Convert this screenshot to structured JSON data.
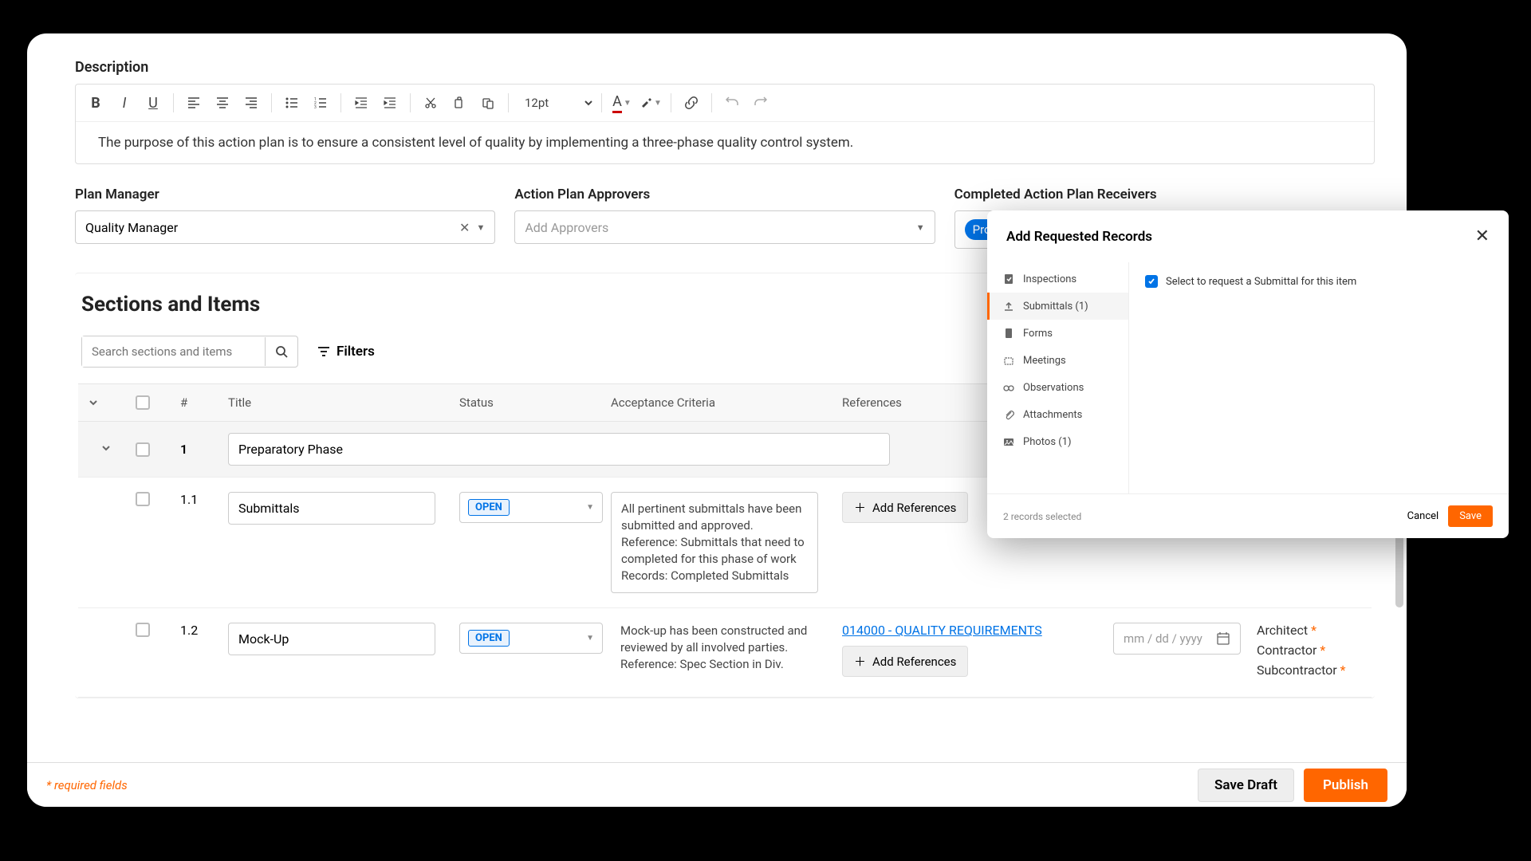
{
  "description": {
    "label": "Description",
    "font_size": "12pt",
    "content": "The purpose of this action plan is to ensure a consistent level of quality by implementing a three-phase quality control system."
  },
  "fields": {
    "plan_manager": {
      "label": "Plan Manager",
      "value": "Quality Manager"
    },
    "approvers": {
      "label": "Action Plan Approvers",
      "placeholder": "Add Approvers"
    },
    "receivers": {
      "label": "Completed Action Plan Receivers",
      "chip": "Project Manager"
    }
  },
  "sections": {
    "title": "Sections and Items",
    "search_placeholder": "Search sections and items",
    "filters_label": "Filters",
    "columns": {
      "num": "#",
      "title": "Title",
      "status": "Status",
      "criteria": "Acceptance Criteria",
      "refs": "References"
    },
    "section1": {
      "num": "1",
      "title": "Preparatory Phase"
    },
    "item11": {
      "num": "1.1",
      "title": "Submittals",
      "status": "OPEN",
      "criteria": "All pertinent submittals have been submitted and approved.\nReference: Submittals that need to completed for this phase of work\nRecords: Completed Submittals",
      "add_ref": "Add References"
    },
    "item12": {
      "num": "1.2",
      "title": "Mock-Up",
      "status": "OPEN",
      "criteria": "Mock-up has been constructed and reviewed by all involved parties.\nReference: Spec Section in Div.",
      "ref_link": "014000 - QUALITY REQUIREMENTS",
      "add_ref": "Add References",
      "date_placeholder": "mm / dd / yyyy",
      "assignees": [
        "Architect",
        "Contractor",
        "Subcontractor"
      ]
    }
  },
  "footer": {
    "required": "* required fields",
    "save_draft": "Save Draft",
    "publish": "Publish"
  },
  "dialog": {
    "title": "Add Requested Records",
    "sidebar": {
      "inspections": "Inspections",
      "submittals": "Submittals (1)",
      "forms": "Forms",
      "meetings": "Meetings",
      "observations": "Observations",
      "attachments": "Attachments",
      "photos": "Photos (1)"
    },
    "checkbox_label": "Select to request a Submittal for this item",
    "selected_text": "2 records selected",
    "cancel": "Cancel",
    "save": "Save"
  }
}
